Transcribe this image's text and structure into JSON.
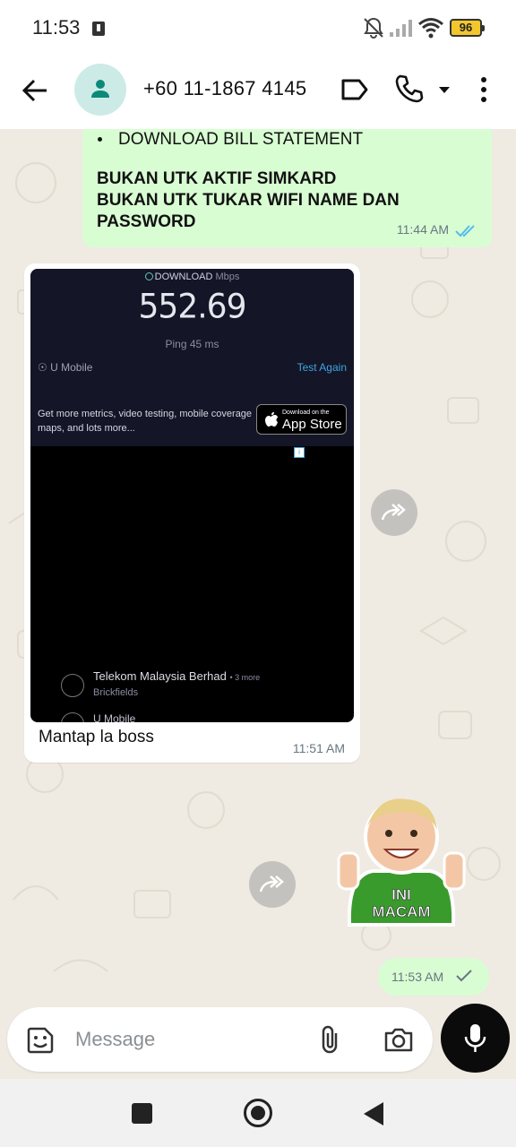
{
  "status_bar": {
    "time": "11:53",
    "battery": "96"
  },
  "header": {
    "contact_name": "+60 11-1867 4145"
  },
  "messages": [
    {
      "direction": "outgoing",
      "bullet": "DOWNLOAD BILL STATEMENT",
      "lines": [
        "BUKAN UTK AKTIF SIMKARD",
        "BUKAN UTK TUKAR WIFI NAME DAN PASSWORD"
      ],
      "time": "11:44 AM",
      "status": "read"
    },
    {
      "direction": "incoming",
      "image": {
        "download_label": "DOWNLOAD",
        "unit": "Mbps",
        "speed": "552.69",
        "ping": "Ping 45 ms",
        "isp": "U Mobile",
        "test_again": "Test Again",
        "promo": "Get more metrics, video testing, mobile coverage maps, and lots more...",
        "appstore_small": "Download on the",
        "appstore_big": "App Store",
        "server_name": "Telekom Malaysia Berhad",
        "server_more": "• 3 more",
        "server_location": "Brickfields",
        "server2": "U Mobile"
      },
      "caption": "Mantap la boss",
      "time": "11:51 AM"
    },
    {
      "direction": "outgoing",
      "sticker_text": "INI MACAM",
      "time": "11:53 AM",
      "status": "sent"
    }
  ],
  "composer": {
    "placeholder": "Message"
  },
  "colors": {
    "outgoing_bubble": "#d9fdd3",
    "read_tick": "#53bdeb",
    "background": "#efeae2"
  },
  "icons": [
    "back-arrow-icon",
    "person-icon",
    "label-icon",
    "phone-icon",
    "more-vert-icon",
    "forward-icon",
    "emoji-icon",
    "paperclip-icon",
    "camera-icon",
    "mic-icon"
  ]
}
